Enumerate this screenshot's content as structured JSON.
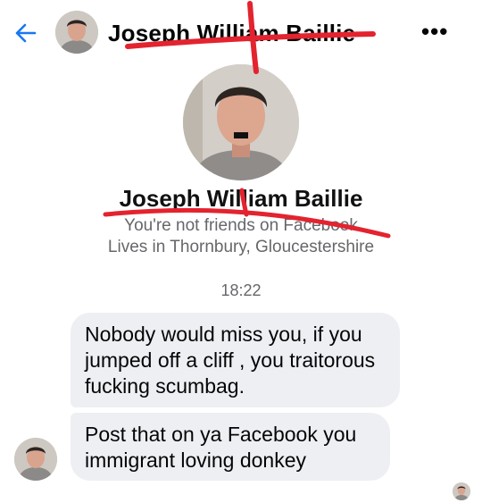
{
  "header": {
    "back_icon": "arrow-left-icon",
    "contact_name": "Joseph William Baillie",
    "more_label": "•••",
    "accent": "#1877f2"
  },
  "profile": {
    "name": "Joseph William Baillie",
    "friend_status": "You're not friends on Facebook",
    "location": "Lives in Thornbury, Gloucestershire"
  },
  "conversation": {
    "timestamp": "18:22",
    "messages": [
      {
        "text": "Nobody would miss you, if you jumped off a cliff , you traitorous fucking scumbag."
      },
      {
        "text": "Post that on ya Facebook you immigrant loving donkey"
      }
    ]
  },
  "annotation_color": "#e3232f"
}
